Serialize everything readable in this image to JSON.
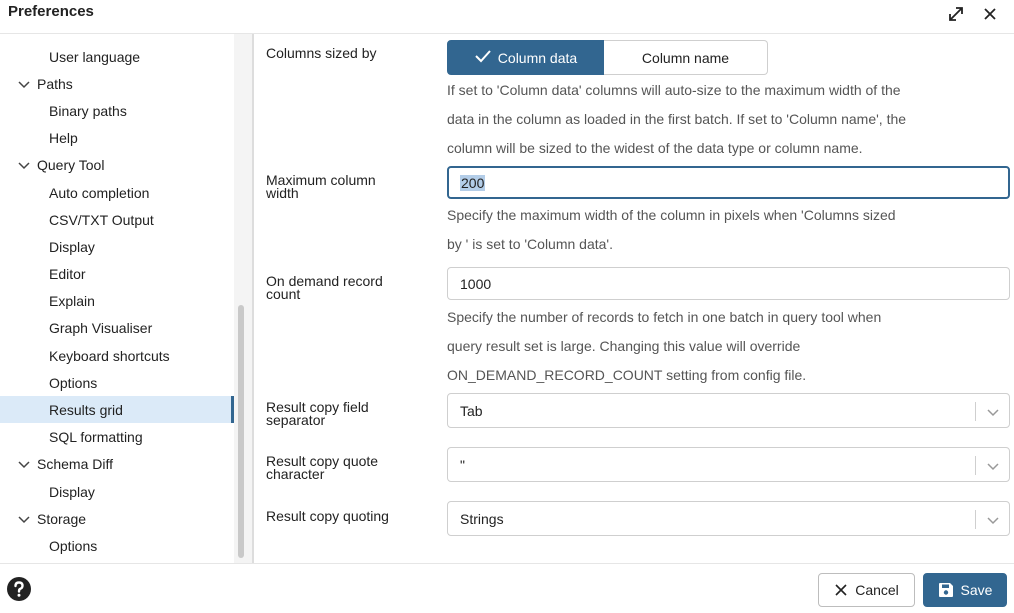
{
  "window": {
    "title": "Preferences",
    "actions": {
      "maximize_icon": "maximize-icon",
      "close_icon": "close-icon"
    }
  },
  "sidebar": {
    "items": [
      {
        "label": "User language",
        "level": "child"
      },
      {
        "label": "Paths",
        "level": "group",
        "expanded": true
      },
      {
        "label": "Binary paths",
        "level": "child"
      },
      {
        "label": "Help",
        "level": "child"
      },
      {
        "label": "Query Tool",
        "level": "group",
        "expanded": true
      },
      {
        "label": "Auto completion",
        "level": "child"
      },
      {
        "label": "CSV/TXT Output",
        "level": "child"
      },
      {
        "label": "Display",
        "level": "child"
      },
      {
        "label": "Editor",
        "level": "child"
      },
      {
        "label": "Explain",
        "level": "child"
      },
      {
        "label": "Graph Visualiser",
        "level": "child"
      },
      {
        "label": "Keyboard shortcuts",
        "level": "child"
      },
      {
        "label": "Options",
        "level": "child"
      },
      {
        "label": "Results grid",
        "level": "child",
        "selected": true
      },
      {
        "label": "SQL formatting",
        "level": "child"
      },
      {
        "label": "Schema Diff",
        "level": "group",
        "expanded": true
      },
      {
        "label": "Display",
        "level": "child"
      },
      {
        "label": "Storage",
        "level": "group",
        "expanded": true
      },
      {
        "label": "Options",
        "level": "child"
      }
    ]
  },
  "settings": {
    "columns_sized_by": {
      "label": "Columns sized by",
      "options": [
        "Column data",
        "Column name"
      ],
      "selected": "Column data",
      "help": [
        "If set to 'Column data' columns will auto-size to the maximum width of the",
        "data in the column as loaded in the first batch. If set to 'Column name', the",
        "column will be sized to the widest of the data type or column name."
      ]
    },
    "max_column_width": {
      "label_line1": "Maximum column",
      "label_line2": "width",
      "value": "200",
      "help": [
        "Specify the maximum width of the column in pixels when 'Columns sized",
        "by ' is set to 'Column data'."
      ]
    },
    "on_demand_record_count": {
      "label_line1": "On demand record",
      "label_line2": "count",
      "value": "1000",
      "help": [
        "Specify the number of records to fetch in one batch in query tool when",
        "query result set is large. Changing this value will override",
        "ON_DEMAND_RECORD_COUNT setting from config file."
      ]
    },
    "copy_field_separator": {
      "label_line1": "Result copy field",
      "label_line2": "separator",
      "value": "Tab"
    },
    "copy_quote_character": {
      "label_line1": "Result copy quote",
      "label_line2": "character",
      "value": "\""
    },
    "copy_quoting": {
      "label": "Result copy quoting",
      "value": "Strings"
    }
  },
  "footer": {
    "help_icon": "help-icon",
    "cancel_label": "Cancel",
    "save_label": "Save"
  },
  "colors": {
    "accent": "#326690",
    "selected_bg": "#dbeaf8",
    "help_text": "#555555"
  }
}
